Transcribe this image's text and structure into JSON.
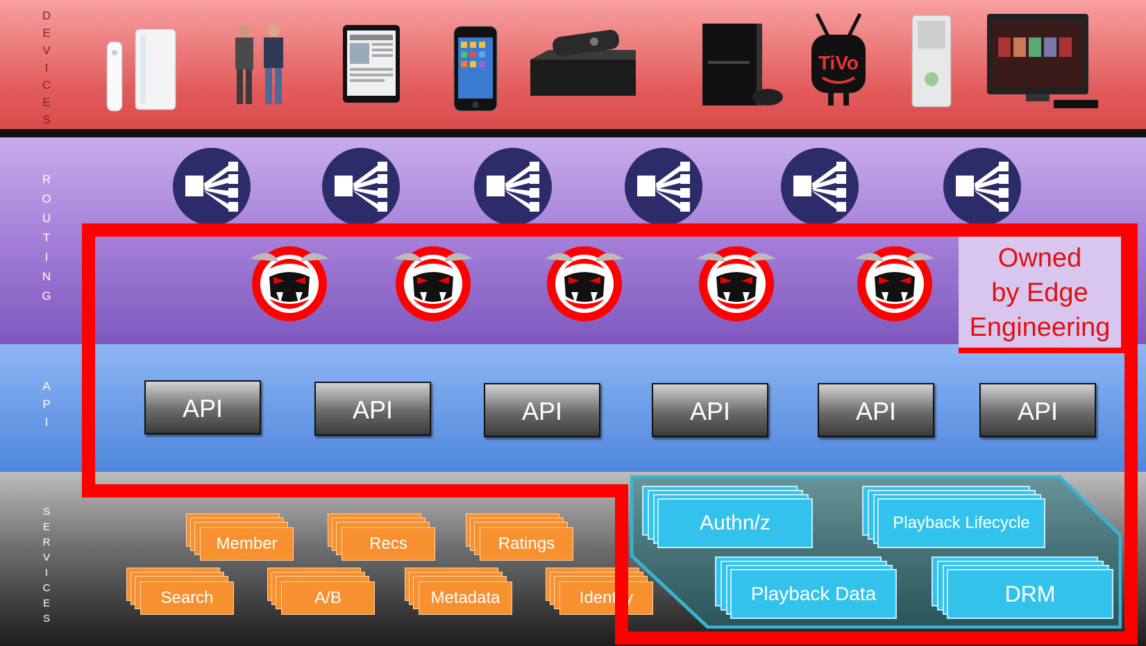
{
  "bands": {
    "devices_label": "D\nE\nV\nI\nC\nE\nS",
    "routing_label": "R\nO\nU\nT\nI\nN\nG",
    "api_label": "A\nP\nI",
    "services_label": "S\nE\nR\nV\nI\nC\nE\nS"
  },
  "devices": [
    {
      "name": "wii-console-icon"
    },
    {
      "name": "people-kinect-icon"
    },
    {
      "name": "ipad-tablet-icon"
    },
    {
      "name": "iphone-icon"
    },
    {
      "name": "set-top-box-icon"
    },
    {
      "name": "ps3-console-icon"
    },
    {
      "name": "tivo-logo-icon"
    },
    {
      "name": "xbox-console-icon"
    },
    {
      "name": "smart-tv-icon"
    }
  ],
  "tivo_logo_text": "TiVo",
  "owned_box": {
    "text": "Owned\nby Edge\nEngineering",
    "border_color": "#ff0000"
  },
  "api_boxes": [
    "API",
    "API",
    "API",
    "API",
    "API",
    "API"
  ],
  "services": {
    "row1": [
      "Member",
      "Recs",
      "Ratings"
    ],
    "row2": [
      "Search",
      "A/B",
      "Metadata",
      "Identity"
    ]
  },
  "secure_services": {
    "authnz": "Authn/z",
    "playback_lifecycle": "Playback Lifecycle",
    "playback_data": "Playback Data",
    "drm": "DRM"
  },
  "colors": {
    "devices_band": "#e25b5b",
    "routing_band": "#a17ad6",
    "api_band": "#4f86dc",
    "service_orange": "#f7902e",
    "secure_blue": "#33c2ec",
    "router_navy": "#2c2c6a"
  }
}
